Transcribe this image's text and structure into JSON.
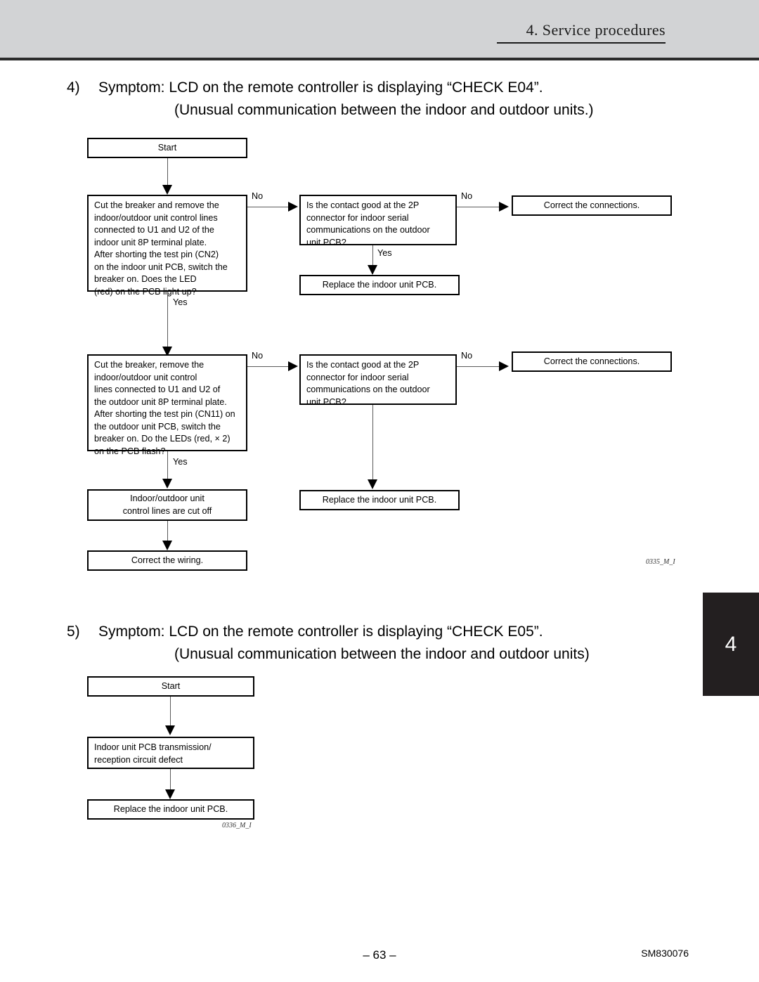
{
  "header": {
    "title": "4. Service procedures",
    "chapter_tab": "4"
  },
  "sections": [
    {
      "number": "4)",
      "line1": "Symptom:  LCD on the remote controller is displaying “CHECK E04”.",
      "line2": "(Unusual communication between the indoor and outdoor units.)",
      "figure_ref": "0335_M_I"
    },
    {
      "number": "5)",
      "line1": "Symptom:  LCD on the remote controller is displaying “CHECK E05”.",
      "line2": "(Unusual communication between the indoor and outdoor units)",
      "figure_ref": "0336_M_I"
    }
  ],
  "flowchart_e04": {
    "start": "Start",
    "step_indoor": "Cut the breaker and remove the\nindoor/outdoor unit control lines\nconnected to U1 and U2 of the\nindoor unit 8P terminal plate.\nAfter shorting the test pin (CN2)\non the indoor unit PCB, switch the\nbreaker on.  Does the LED\n(red) on the PCB light up?",
    "decision_1": "Is the contact good at the 2P\nconnector for indoor serial\ncommunications on the outdoor\nunit PCB?",
    "correct_connections_1": "Correct the connections.",
    "replace_pcb_1": "Replace the indoor unit PCB.",
    "step_outdoor": "Cut the breaker, remove the\nindoor/outdoor unit control\nlines connected to U1 and U2 of\nthe outdoor unit 8P terminal plate.\nAfter shorting the test pin (CN11) on\nthe outdoor unit PCB, switch the\nbreaker on. Do the LEDs (red, × 2)\non the PCB flash?",
    "decision_2": "Is the contact good at the 2P\nconnector for indoor serial\ncommunications on the outdoor\nunit PCB?",
    "correct_connections_2": "Correct the connections.",
    "replace_pcb_2": "Replace the indoor unit PCB.",
    "lines_cut_off": "Indoor/outdoor unit\ncontrol lines are cut off",
    "correct_wiring": "Correct the wiring.",
    "labels": {
      "no_1": "No",
      "yes_1": "Yes",
      "no_decision_1": "No",
      "yes_decision_1": "Yes",
      "no_2": "No",
      "yes_2": "Yes",
      "no_decision_2": "No"
    }
  },
  "flowchart_e05": {
    "start": "Start",
    "defect": "Indoor unit PCB transmission/\nreception circuit defect",
    "replace_pcb": "Replace the indoor unit PCB."
  },
  "footer": {
    "page_number": "– 63 –",
    "doc_id": "SM830076"
  }
}
